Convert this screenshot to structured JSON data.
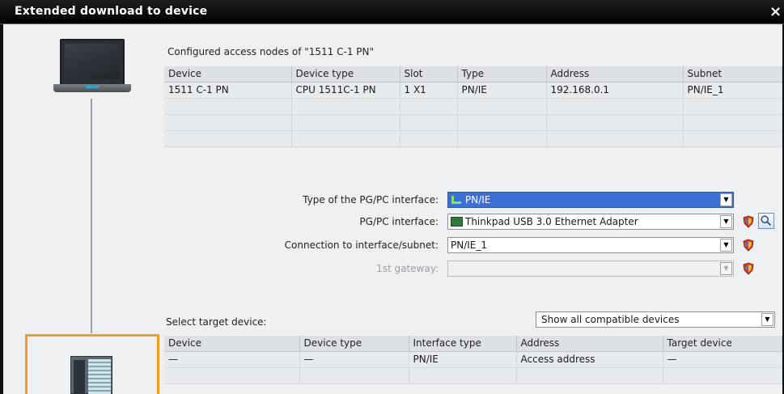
{
  "window": {
    "title": "Extended download to device",
    "close_glyph": "×"
  },
  "configured": {
    "label": "Configured access nodes of \"1511 C-1 PN\"",
    "columns": [
      "Device",
      "Device type",
      "Slot",
      "Type",
      "Address",
      "Subnet"
    ],
    "rows": [
      [
        "1511 C-1 PN",
        "CPU 1511C-1 PN",
        "1 X1",
        "PN/IE",
        "192.168.0.1",
        "PN/IE_1"
      ]
    ]
  },
  "form": {
    "type_label": "Type of the PG/PC interface:",
    "type_value": "PN/IE",
    "pgpc_label": "PG/PC interface:",
    "pgpc_value": "Thinkpad USB 3.0 Ethernet Adapter",
    "conn_label": "Connection to interface/subnet:",
    "conn_value": "PN/IE_1",
    "gateway_label": "1st gateway:",
    "gateway_value": ""
  },
  "target": {
    "label": "Select target device:",
    "filter_value": "Show all compatible devices",
    "columns": [
      "Device",
      "Device type",
      "Interface type",
      "Address",
      "Target device"
    ],
    "rows": [
      [
        "—",
        "—",
        "PN/IE",
        "Access address",
        "—"
      ]
    ]
  },
  "icons": {
    "network": "network-icon",
    "adapter": "ethernet-adapter-icon",
    "shield": "status-shield-icon",
    "search": "search-icon",
    "dropdown": "chevron-down-icon"
  },
  "colors": {
    "selection": "#3b6fd4",
    "target_frame": "#f29c1f"
  }
}
